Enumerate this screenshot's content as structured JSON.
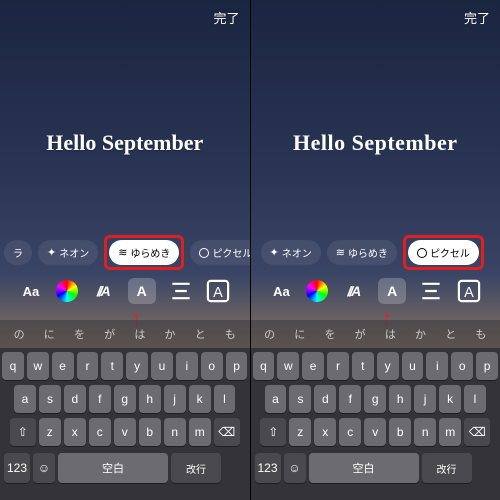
{
  "done_label": "完了",
  "main_text": "Hello September",
  "effects": {
    "partial_left": "ラ",
    "neon": "ネオン",
    "yurameki": "ゆらめき",
    "pixel": "ピクセル"
  },
  "toolbar": {
    "aa": "Aa",
    "italic": "//A",
    "effect": "A"
  },
  "suggestions": [
    "の",
    "に",
    "を",
    "が",
    "は",
    "か",
    "と",
    "も"
  ],
  "keyboard": {
    "row1": [
      "q",
      "w",
      "e",
      "r",
      "t",
      "y",
      "u",
      "i",
      "o",
      "p"
    ],
    "row2": [
      "a",
      "s",
      "d",
      "f",
      "g",
      "h",
      "j",
      "k",
      "l"
    ],
    "row3": [
      "z",
      "x",
      "c",
      "v",
      "b",
      "n",
      "m"
    ],
    "num": "123",
    "space": "空白",
    "return": "改行"
  },
  "left_active": "yurameki",
  "right_active": "pixel"
}
